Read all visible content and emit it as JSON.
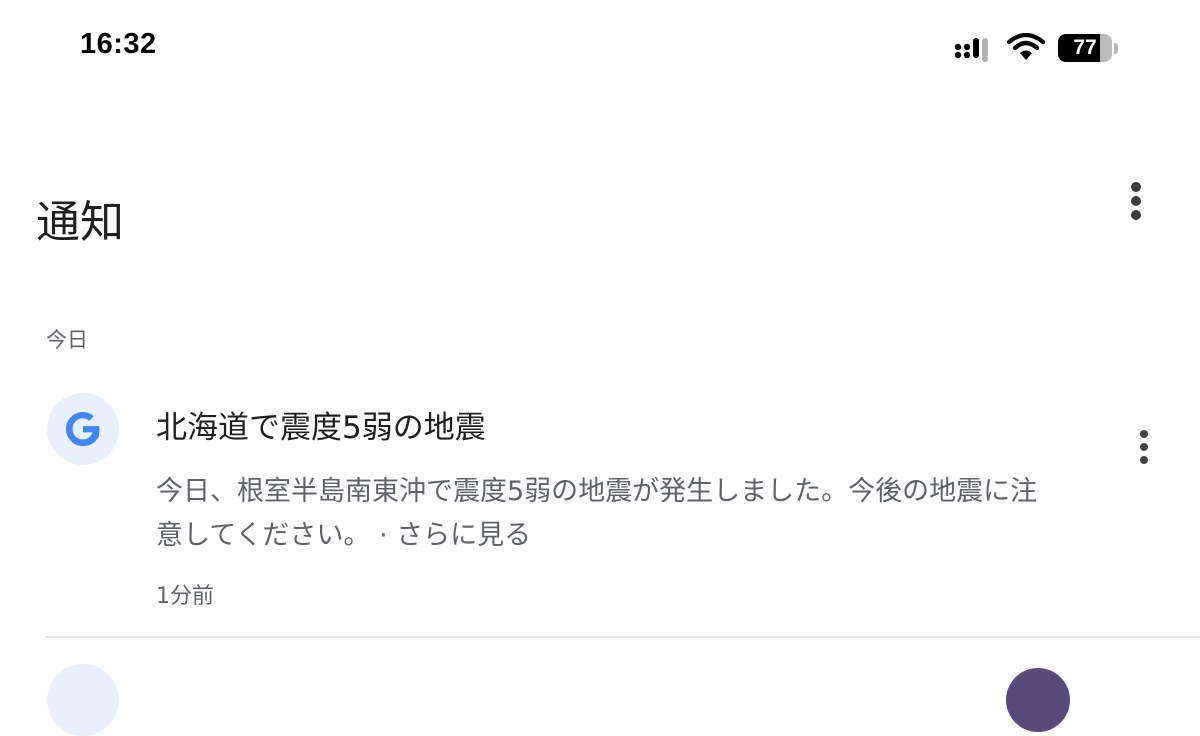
{
  "status_bar": {
    "time": "16:32",
    "battery_level": "77",
    "battery_fraction": 0.77,
    "icons": [
      "signal-icon",
      "wifi-icon",
      "battery-icon"
    ]
  },
  "header": {
    "title": "通知",
    "menu_icon": "more-vertical-icon"
  },
  "sections": [
    {
      "label": "今日",
      "notifications": [
        {
          "app_icon": "google-g-icon",
          "title": "北海道で震度5弱の地震",
          "body": "今日、根室半島南東沖で震度5弱の地震が発生しました。今後の地震に注意してください。",
          "separator": " · ",
          "more_link": "さらに見る",
          "time": "1分前",
          "menu_icon": "more-vertical-icon"
        }
      ]
    }
  ],
  "colors": {
    "google_blue": "#4285F4",
    "avatar_bg": "#e8f0fe",
    "secondary_text": "#5f6368",
    "primary_text": "#1f1f1f"
  }
}
